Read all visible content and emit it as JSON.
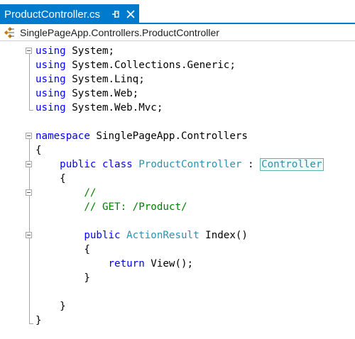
{
  "tab": {
    "title": "ProductController.cs",
    "pin_icon": "pin-icon",
    "close_icon": "close-icon",
    "accent": "#007acc"
  },
  "navbar": {
    "icon": "class-icon",
    "text": "SinglePageApp.Controllers.ProductController"
  },
  "colors": {
    "keyword": "#0000ff",
    "type": "#2b91af",
    "comment": "#008000"
  },
  "code": {
    "l1": {
      "kw": "using",
      "rest": " System;"
    },
    "l2": {
      "kw": "using",
      "rest": " System.Collections.Generic;"
    },
    "l3": {
      "kw": "using",
      "rest": " System.Linq;"
    },
    "l4": {
      "kw": "using",
      "rest": " System.Web;"
    },
    "l5": {
      "kw": "using",
      "rest": " System.Web.Mvc;"
    },
    "l7": {
      "kw": "namespace",
      "rest": " SinglePageApp.Controllers"
    },
    "l8": {
      "text": "{"
    },
    "l9": {
      "kw1": "public",
      "kw2": "class",
      "type": "ProductController",
      "sep": " : ",
      "base": "Controller"
    },
    "l10": {
      "text": "{"
    },
    "l11": {
      "comment": "//"
    },
    "l12": {
      "comment": "// GET: /Product/"
    },
    "l14": {
      "kw": "public",
      "type": "ActionResult",
      "rest": " Index()"
    },
    "l15": {
      "text": "{"
    },
    "l16": {
      "kw": "return",
      "rest": " View();"
    },
    "l17": {
      "text": "}"
    },
    "l19": {
      "text": "}"
    },
    "l20": {
      "text": "}"
    }
  }
}
